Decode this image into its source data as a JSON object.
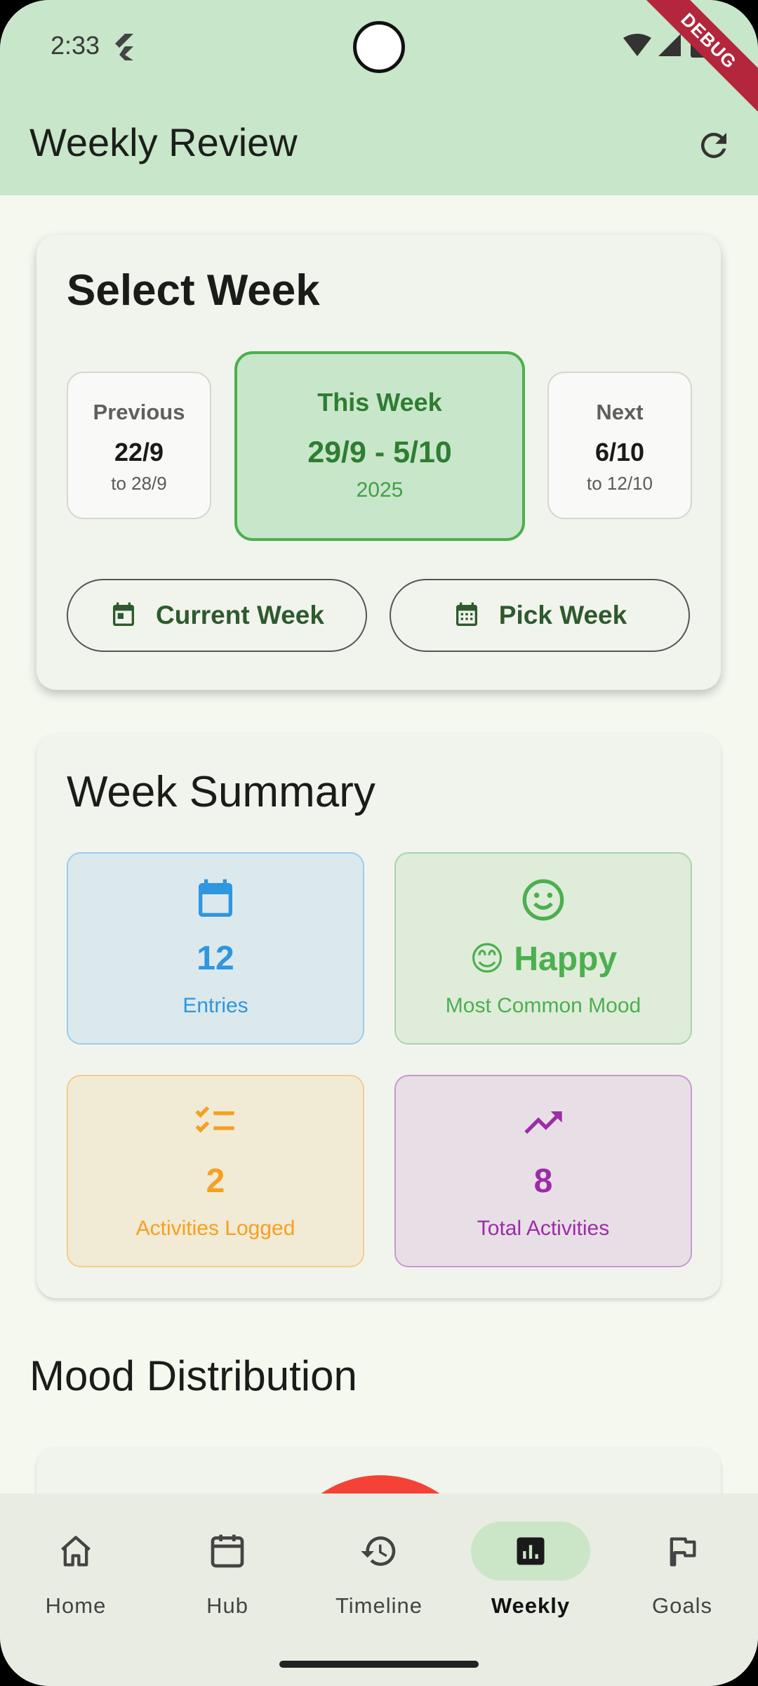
{
  "status_bar": {
    "time": "2:33"
  },
  "debug_banner": "DEBUG",
  "app_bar": {
    "title": "Weekly Review",
    "refresh_icon": "refresh-icon"
  },
  "select_week": {
    "title": "Select Week",
    "previous": {
      "label": "Previous",
      "date": "22/9",
      "range_end": "to 28/9"
    },
    "current": {
      "label": "This Week",
      "range": "29/9 - 5/10",
      "year": "2025"
    },
    "next": {
      "label": "Next",
      "date": "6/10",
      "range_end": "to 12/10"
    },
    "buttons": {
      "current_week": "Current Week",
      "pick_week": "Pick Week"
    }
  },
  "week_summary": {
    "title": "Week Summary",
    "tiles": [
      {
        "value": "12",
        "caption": "Entries",
        "icon": "calendar-icon",
        "color": "#2f96e0"
      },
      {
        "value": "😊 Happy",
        "caption": "Most Common Mood",
        "icon": "smiley-icon",
        "color": "#4caf50"
      },
      {
        "value": "2",
        "caption": "Activities Logged",
        "icon": "checklist-icon",
        "color": "#f6a020"
      },
      {
        "value": "8",
        "caption": "Total Activities",
        "icon": "trending-up-icon",
        "color": "#9c2ca8"
      }
    ]
  },
  "mood_distribution": {
    "title": "Mood Distribution"
  },
  "nav": {
    "items": [
      {
        "label": "Home",
        "icon": "home-icon"
      },
      {
        "label": "Hub",
        "icon": "calendar-icon"
      },
      {
        "label": "Timeline",
        "icon": "history-icon"
      },
      {
        "label": "Weekly",
        "icon": "bar-chart-icon",
        "active": true
      },
      {
        "label": "Goals",
        "icon": "flag-icon"
      }
    ]
  },
  "colors": {
    "accent": "#4caf50",
    "app_bar": "#c8e6c9",
    "background": "#f4f8ef"
  }
}
